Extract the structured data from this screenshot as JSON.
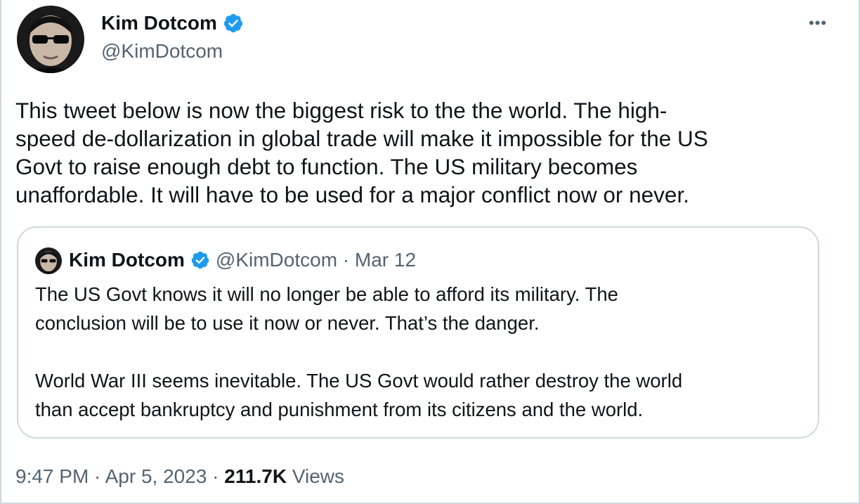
{
  "author": {
    "name": "Kim Dotcom",
    "handle": "@KimDotcom",
    "avatar_icon": "profile-photo",
    "verified_icon": "verified-badge-icon"
  },
  "more_icon": "more-options-icon",
  "more_label": "•••",
  "tweet_text": "This tweet below is now the biggest risk to the the world. The high-\nspeed de-dollarization in global trade will make it impossible for the US\nGovt to raise enough debt to function. The US military becomes\nunaffordable. It will have to be used for a major conflict now or never.",
  "quote": {
    "name": "Kim Dotcom",
    "meta": "@KimDotcom · Mar 12",
    "paragraphs": [
      "The US Govt knows it will no longer be able to afford its military. The\nconclusion will be to use it now or never. That’s the danger.",
      "World War III seems inevitable. The US Govt would rather destroy the world\nthan accept bankruptcy and punishment from its citizens and the world."
    ]
  },
  "footer": {
    "time": "9:47 PM",
    "separator": " · ",
    "date": "Apr 5, 2023",
    "views_count": "211.7K",
    "views_label": " Views"
  },
  "colors": {
    "verified_blue": "#1d9bf0",
    "text": "#0f1419",
    "secondary": "#536471",
    "border": "#cfd9de"
  }
}
